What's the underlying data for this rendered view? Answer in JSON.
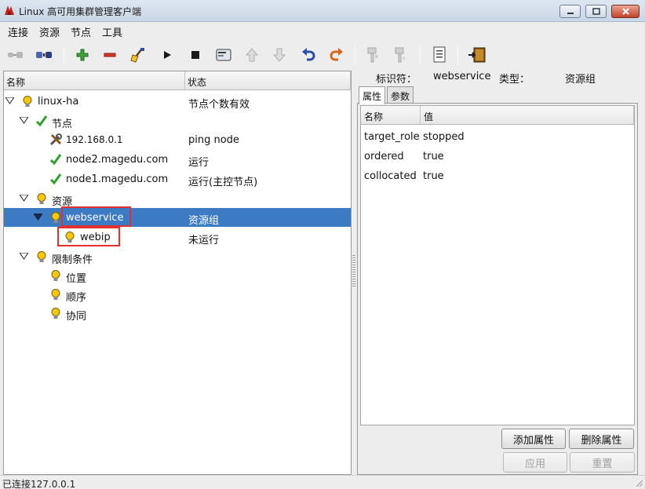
{
  "window": {
    "title": "Linux 高可用集群管理客户端"
  },
  "menu": [
    "连接",
    "资源",
    "节点",
    "工具"
  ],
  "tree": {
    "columns": {
      "name": "名称",
      "status": "状态"
    },
    "rows": [
      {
        "label": "linux-ha",
        "status": "节点个数有效"
      },
      {
        "label": "节点",
        "status": ""
      },
      {
        "label": "192.168.0.1",
        "status": "ping node"
      },
      {
        "label": "node2.magedu.com",
        "status": "运行"
      },
      {
        "label": "node1.magedu.com",
        "status": "运行(主控节点)"
      },
      {
        "label": "资源",
        "status": ""
      },
      {
        "label": "webservice",
        "status": "资源组"
      },
      {
        "label": "webip",
        "status": "未运行"
      },
      {
        "label": "限制条件",
        "status": ""
      },
      {
        "label": "位置",
        "status": ""
      },
      {
        "label": "顺序",
        "status": ""
      },
      {
        "label": "协同",
        "status": ""
      }
    ]
  },
  "details": {
    "id_label": "标识符：",
    "id_value": "webservice",
    "type_label": "类型：",
    "type_value": "资源组",
    "tabs": [
      "属性",
      "参数"
    ],
    "columns": {
      "name": "名称",
      "value": "值"
    },
    "properties": [
      {
        "name": "target_role",
        "value": "stopped"
      },
      {
        "name": "ordered",
        "value": "true"
      },
      {
        "name": "collocated",
        "value": "true"
      }
    ],
    "add_label": "添加属性",
    "delete_label": "删除属性",
    "apply_label": "应用",
    "reset_label": "重置"
  },
  "status_bar": "已连接127.0.0.1",
  "colors": {
    "selection": "#3c7bc3",
    "highlight_box": "#e03030",
    "ok_check": "#2e9e2e",
    "bulb": "#f5c518"
  }
}
